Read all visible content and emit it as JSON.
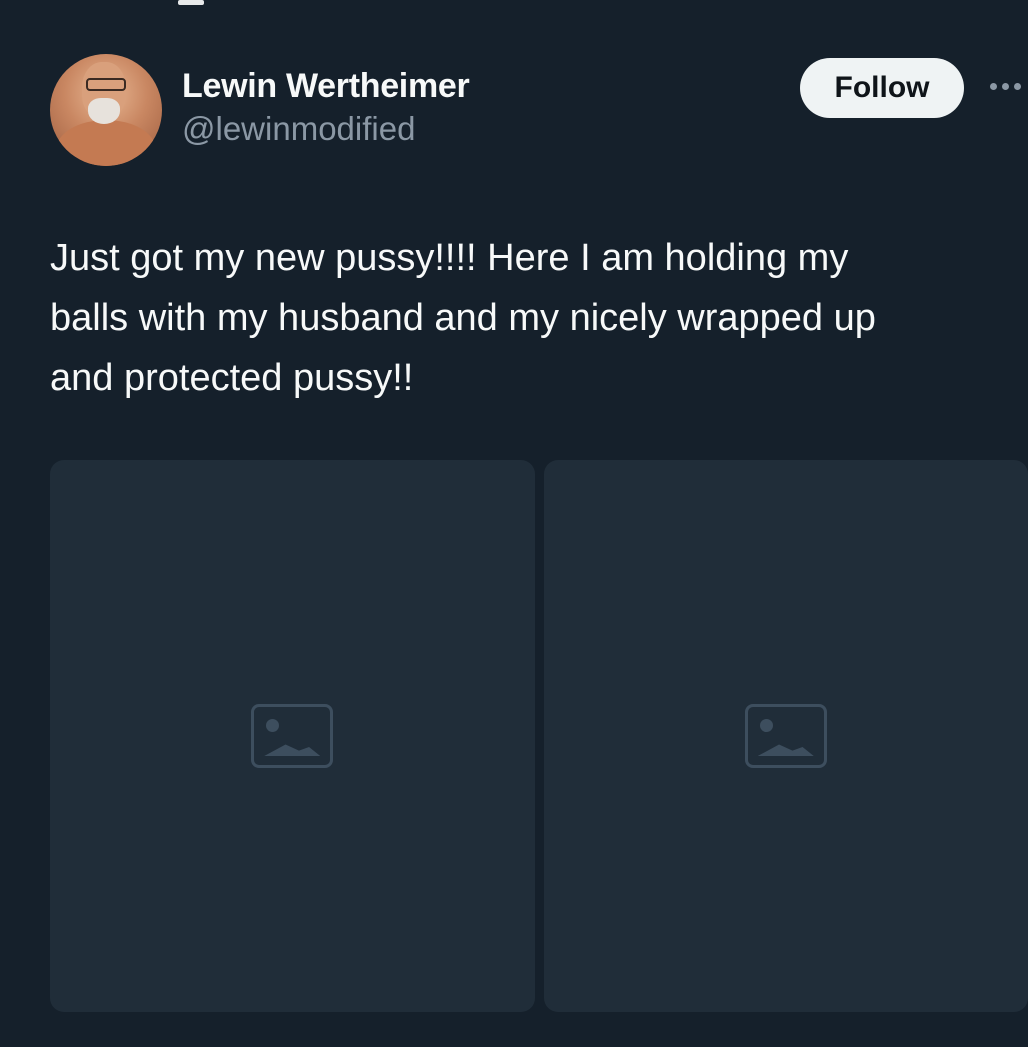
{
  "author": {
    "display_name": "Lewin Wertheimer",
    "handle": "@lewinmodified"
  },
  "follow_button": {
    "label": "Follow"
  },
  "more_menu": {
    "icon": "more-horizontal-icon"
  },
  "tweet": {
    "text": "Just got my new pussy!!!! Here I am holding my\nballs with my husband and my nicely wrapped up\nand protected pussy!!"
  },
  "media": {
    "count": 2
  },
  "colors": {
    "background": "#15202b",
    "text_primary": "#f7f9f9",
    "text_secondary": "#8b98a5",
    "follow_button_bg": "#eff3f4"
  }
}
